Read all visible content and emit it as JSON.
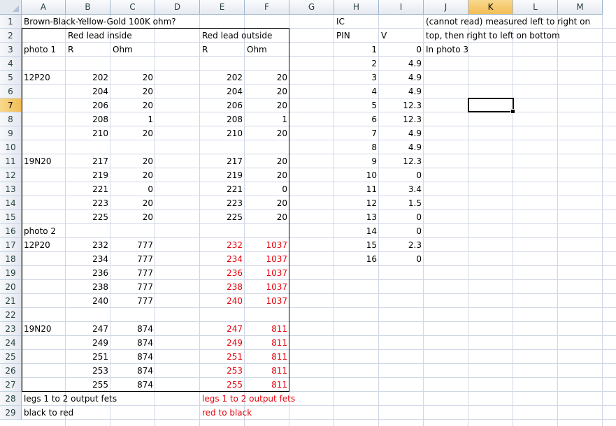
{
  "columns": [
    "A",
    "B",
    "C",
    "D",
    "E",
    "F",
    "G",
    "H",
    "I",
    "J",
    "K",
    "L",
    "M"
  ],
  "rows": [
    "1",
    "2",
    "3",
    "4",
    "5",
    "6",
    "7",
    "8",
    "9",
    "10",
    "11",
    "12",
    "13",
    "14",
    "15",
    "16",
    "17",
    "18",
    "19",
    "20",
    "21",
    "22",
    "23",
    "24",
    "25",
    "26",
    "27",
    "28",
    "29"
  ],
  "active_column": "K",
  "active_row": "7",
  "colors": {
    "red_text": "#e8000b",
    "grid": "#d0d7e5",
    "header_selected": "#f2bd55"
  },
  "cells": [
    {
      "ref": "A1",
      "t": "Brown-Black-Yellow-Gold 100K ohm?"
    },
    {
      "ref": "H1",
      "t": "IC"
    },
    {
      "ref": "J1",
      "t": "(cannot read) measured left to right on"
    },
    {
      "ref": "B2",
      "t": "Red lead inside"
    },
    {
      "ref": "E2",
      "t": "Red lead outside"
    },
    {
      "ref": "H2",
      "t": "PIN"
    },
    {
      "ref": "I2",
      "t": "V"
    },
    {
      "ref": "J2",
      "t": "top, then right to left on bottom"
    },
    {
      "ref": "A3",
      "t": "photo 1"
    },
    {
      "ref": "B3",
      "t": "R"
    },
    {
      "ref": "C3",
      "t": "Ohm"
    },
    {
      "ref": "E3",
      "t": "R"
    },
    {
      "ref": "F3",
      "t": "Ohm"
    },
    {
      "ref": "H3",
      "t": "1",
      "n": true
    },
    {
      "ref": "I3",
      "t": "0",
      "n": true
    },
    {
      "ref": "J3",
      "t": "In photo 3"
    },
    {
      "ref": "H4",
      "t": "2",
      "n": true
    },
    {
      "ref": "I4",
      "t": "4.9",
      "n": true
    },
    {
      "ref": "A5",
      "t": "12P20"
    },
    {
      "ref": "B5",
      "t": "202",
      "n": true
    },
    {
      "ref": "C5",
      "t": "20",
      "n": true
    },
    {
      "ref": "E5",
      "t": "202",
      "n": true
    },
    {
      "ref": "F5",
      "t": "20",
      "n": true
    },
    {
      "ref": "H5",
      "t": "3",
      "n": true
    },
    {
      "ref": "I5",
      "t": "4.9",
      "n": true
    },
    {
      "ref": "B6",
      "t": "204",
      "n": true
    },
    {
      "ref": "C6",
      "t": "20",
      "n": true
    },
    {
      "ref": "E6",
      "t": "204",
      "n": true
    },
    {
      "ref": "F6",
      "t": "20",
      "n": true
    },
    {
      "ref": "H6",
      "t": "4",
      "n": true
    },
    {
      "ref": "I6",
      "t": "4.9",
      "n": true
    },
    {
      "ref": "B7",
      "t": "206",
      "n": true
    },
    {
      "ref": "C7",
      "t": "20",
      "n": true
    },
    {
      "ref": "E7",
      "t": "206",
      "n": true
    },
    {
      "ref": "F7",
      "t": "20",
      "n": true
    },
    {
      "ref": "H7",
      "t": "5",
      "n": true
    },
    {
      "ref": "I7",
      "t": "12.3",
      "n": true
    },
    {
      "ref": "B8",
      "t": "208",
      "n": true
    },
    {
      "ref": "C8",
      "t": "1",
      "n": true
    },
    {
      "ref": "E8",
      "t": "208",
      "n": true
    },
    {
      "ref": "F8",
      "t": "1",
      "n": true
    },
    {
      "ref": "H8",
      "t": "6",
      "n": true
    },
    {
      "ref": "I8",
      "t": "12.3",
      "n": true
    },
    {
      "ref": "B9",
      "t": "210",
      "n": true
    },
    {
      "ref": "C9",
      "t": "20",
      "n": true
    },
    {
      "ref": "E9",
      "t": "210",
      "n": true
    },
    {
      "ref": "F9",
      "t": "20",
      "n": true
    },
    {
      "ref": "H9",
      "t": "7",
      "n": true
    },
    {
      "ref": "I9",
      "t": "4.9",
      "n": true
    },
    {
      "ref": "H10",
      "t": "8",
      "n": true
    },
    {
      "ref": "I10",
      "t": "4.9",
      "n": true
    },
    {
      "ref": "A11",
      "t": "19N20"
    },
    {
      "ref": "B11",
      "t": "217",
      "n": true
    },
    {
      "ref": "C11",
      "t": "20",
      "n": true
    },
    {
      "ref": "E11",
      "t": "217",
      "n": true
    },
    {
      "ref": "F11",
      "t": "20",
      "n": true
    },
    {
      "ref": "H11",
      "t": "9",
      "n": true
    },
    {
      "ref": "I11",
      "t": "12.3",
      "n": true
    },
    {
      "ref": "B12",
      "t": "219",
      "n": true
    },
    {
      "ref": "C12",
      "t": "20",
      "n": true
    },
    {
      "ref": "E12",
      "t": "219",
      "n": true
    },
    {
      "ref": "F12",
      "t": "20",
      "n": true
    },
    {
      "ref": "H12",
      "t": "10",
      "n": true
    },
    {
      "ref": "I12",
      "t": "0",
      "n": true
    },
    {
      "ref": "B13",
      "t": "221",
      "n": true
    },
    {
      "ref": "C13",
      "t": "0",
      "n": true
    },
    {
      "ref": "E13",
      "t": "221",
      "n": true
    },
    {
      "ref": "F13",
      "t": "0",
      "n": true
    },
    {
      "ref": "H13",
      "t": "11",
      "n": true
    },
    {
      "ref": "I13",
      "t": "3.4",
      "n": true
    },
    {
      "ref": "B14",
      "t": "223",
      "n": true
    },
    {
      "ref": "C14",
      "t": "20",
      "n": true
    },
    {
      "ref": "E14",
      "t": "223",
      "n": true
    },
    {
      "ref": "F14",
      "t": "20",
      "n": true
    },
    {
      "ref": "H14",
      "t": "12",
      "n": true
    },
    {
      "ref": "I14",
      "t": "1.5",
      "n": true
    },
    {
      "ref": "B15",
      "t": "225",
      "n": true
    },
    {
      "ref": "C15",
      "t": "20",
      "n": true
    },
    {
      "ref": "E15",
      "t": "225",
      "n": true
    },
    {
      "ref": "F15",
      "t": "20",
      "n": true
    },
    {
      "ref": "H15",
      "t": "13",
      "n": true
    },
    {
      "ref": "I15",
      "t": "0",
      "n": true
    },
    {
      "ref": "A16",
      "t": "photo 2"
    },
    {
      "ref": "H16",
      "t": "14",
      "n": true
    },
    {
      "ref": "I16",
      "t": "0",
      "n": true
    },
    {
      "ref": "A17",
      "t": "12P20"
    },
    {
      "ref": "B17",
      "t": "232",
      "n": true
    },
    {
      "ref": "C17",
      "t": "777",
      "n": true
    },
    {
      "ref": "E17",
      "t": "232",
      "n": true,
      "red": true
    },
    {
      "ref": "F17",
      "t": "1037",
      "n": true,
      "red": true
    },
    {
      "ref": "H17",
      "t": "15",
      "n": true
    },
    {
      "ref": "I17",
      "t": "2.3",
      "n": true
    },
    {
      "ref": "B18",
      "t": "234",
      "n": true
    },
    {
      "ref": "C18",
      "t": "777",
      "n": true
    },
    {
      "ref": "E18",
      "t": "234",
      "n": true,
      "red": true
    },
    {
      "ref": "F18",
      "t": "1037",
      "n": true,
      "red": true
    },
    {
      "ref": "H18",
      "t": "16",
      "n": true
    },
    {
      "ref": "I18",
      "t": "0",
      "n": true
    },
    {
      "ref": "B19",
      "t": "236",
      "n": true
    },
    {
      "ref": "C19",
      "t": "777",
      "n": true
    },
    {
      "ref": "E19",
      "t": "236",
      "n": true,
      "red": true
    },
    {
      "ref": "F19",
      "t": "1037",
      "n": true,
      "red": true
    },
    {
      "ref": "B20",
      "t": "238",
      "n": true
    },
    {
      "ref": "C20",
      "t": "777",
      "n": true
    },
    {
      "ref": "E20",
      "t": "238",
      "n": true,
      "red": true
    },
    {
      "ref": "F20",
      "t": "1037",
      "n": true,
      "red": true
    },
    {
      "ref": "B21",
      "t": "240",
      "n": true
    },
    {
      "ref": "C21",
      "t": "777",
      "n": true
    },
    {
      "ref": "E21",
      "t": "240",
      "n": true,
      "red": true
    },
    {
      "ref": "F21",
      "t": "1037",
      "n": true,
      "red": true
    },
    {
      "ref": "A23",
      "t": "19N20"
    },
    {
      "ref": "B23",
      "t": "247",
      "n": true
    },
    {
      "ref": "C23",
      "t": "874",
      "n": true
    },
    {
      "ref": "E23",
      "t": "247",
      "n": true,
      "red": true
    },
    {
      "ref": "F23",
      "t": "811",
      "n": true,
      "red": true
    },
    {
      "ref": "B24",
      "t": "249",
      "n": true
    },
    {
      "ref": "C24",
      "t": "874",
      "n": true
    },
    {
      "ref": "E24",
      "t": "249",
      "n": true,
      "red": true
    },
    {
      "ref": "F24",
      "t": "811",
      "n": true,
      "red": true
    },
    {
      "ref": "B25",
      "t": "251",
      "n": true
    },
    {
      "ref": "C25",
      "t": "874",
      "n": true
    },
    {
      "ref": "E25",
      "t": "251",
      "n": true,
      "red": true
    },
    {
      "ref": "F25",
      "t": "811",
      "n": true,
      "red": true
    },
    {
      "ref": "B26",
      "t": "253",
      "n": true
    },
    {
      "ref": "C26",
      "t": "874",
      "n": true
    },
    {
      "ref": "E26",
      "t": "253",
      "n": true,
      "red": true
    },
    {
      "ref": "F26",
      "t": "811",
      "n": true,
      "red": true
    },
    {
      "ref": "B27",
      "t": "255",
      "n": true
    },
    {
      "ref": "C27",
      "t": "874",
      "n": true
    },
    {
      "ref": "E27",
      "t": "255",
      "n": true,
      "red": true
    },
    {
      "ref": "F27",
      "t": "811",
      "n": true,
      "red": true
    },
    {
      "ref": "A28",
      "t": "legs 1 to 2 output fets"
    },
    {
      "ref": "E28",
      "t": "legs 1 to 2 output fets",
      "red": true
    },
    {
      "ref": "A29",
      "t": "black to red"
    },
    {
      "ref": "E29",
      "t": "red to black",
      "red": true
    }
  ]
}
